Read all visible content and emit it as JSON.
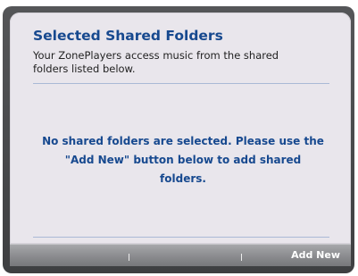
{
  "dialog": {
    "title": "Selected Shared Folders",
    "description": "Your ZonePlayers access music from the shared folders listed below.",
    "empty_message": "No shared folders are selected. Please use the \"Add New\" button below to add shared folders."
  },
  "toolbar": {
    "add_new_label": "Add New"
  },
  "colors": {
    "accent_blue": "#17498f",
    "panel_background": "#e9e6ec",
    "frame_dark": "#4a4b4d",
    "button_bar": "#8a8b8e"
  },
  "icons": []
}
